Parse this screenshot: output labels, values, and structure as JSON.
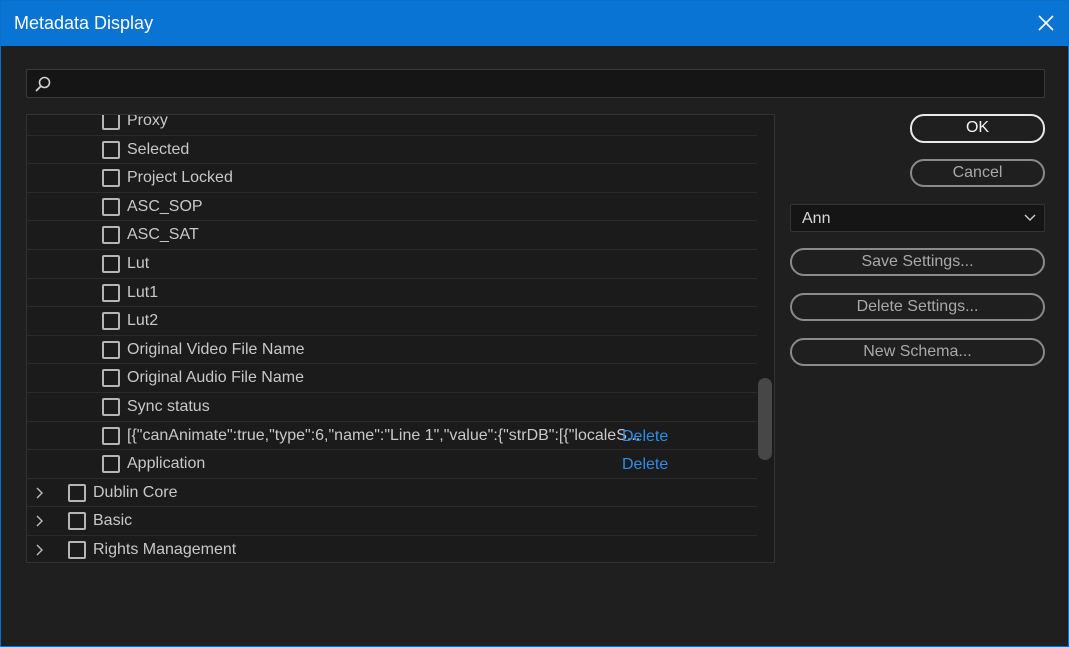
{
  "window": {
    "title": "Metadata Display"
  },
  "search": {
    "placeholder": "",
    "value": ""
  },
  "list": {
    "children": [
      {
        "label": "Proxy",
        "delete": ""
      },
      {
        "label": "Selected",
        "delete": ""
      },
      {
        "label": "Project Locked",
        "delete": ""
      },
      {
        "label": "ASC_SOP",
        "delete": ""
      },
      {
        "label": "ASC_SAT",
        "delete": ""
      },
      {
        "label": "Lut",
        "delete": ""
      },
      {
        "label": "Lut1",
        "delete": ""
      },
      {
        "label": "Lut2",
        "delete": ""
      },
      {
        "label": "Original Video File Name",
        "delete": ""
      },
      {
        "label": "Original Audio File Name",
        "delete": ""
      },
      {
        "label": "Sync status",
        "delete": ""
      },
      {
        "label": "[{\"canAnimate\":true,\"type\":6,\"name\":\"Line 1\",\"value\":{\"strDB\":[{\"localeS...",
        "delete": "Delete"
      },
      {
        "label": "Application",
        "delete": "Delete"
      }
    ],
    "groups": [
      {
        "label": "Dublin Core"
      },
      {
        "label": "Basic"
      },
      {
        "label": "Rights Management"
      }
    ]
  },
  "buttons": {
    "ok": "OK",
    "cancel": "Cancel",
    "save_settings": "Save Settings...",
    "delete_settings": "Delete Settings...",
    "new_schema": "New Schema..."
  },
  "settings_select": {
    "value": "Ann"
  },
  "colors": {
    "titlebar": "#0a74d4",
    "background": "#1f1f1f",
    "link": "#2f8ce8"
  }
}
